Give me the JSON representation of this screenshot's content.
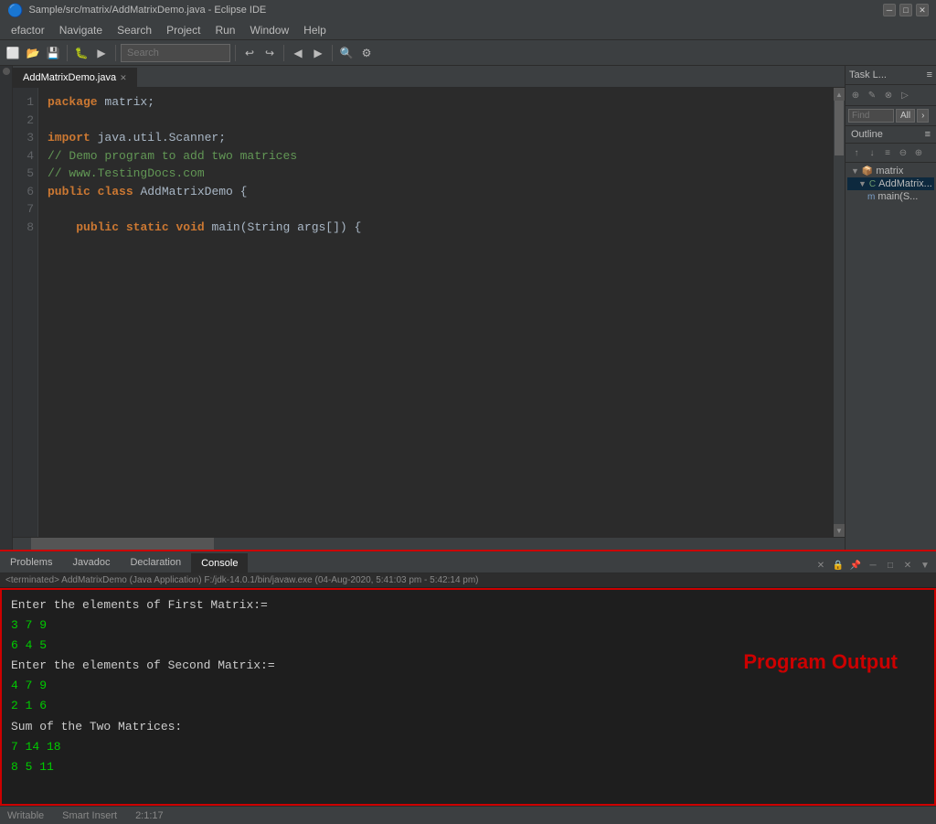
{
  "titlebar": {
    "title": "Sample/src/matrix/AddMatrixDemo.java - Eclipse IDE",
    "minimize": "─",
    "maximize": "□",
    "close": "✕"
  },
  "menubar": {
    "items": [
      "efactor",
      "Navigate",
      "Search",
      "Project",
      "Run",
      "Window",
      "Help"
    ]
  },
  "toolbar": {
    "search_placeholder": "Search"
  },
  "editor": {
    "tab": "AddMatrixDemo.java",
    "lines": [
      {
        "num": "1",
        "content": "package matrix;",
        "parts": [
          {
            "t": "keyword",
            "v": "package"
          },
          {
            "t": "normal",
            "v": " matrix;"
          }
        ]
      },
      {
        "num": "2",
        "content": ""
      },
      {
        "num": "3",
        "content": "import java.util.Scanner;",
        "parts": [
          {
            "t": "keyword",
            "v": "import"
          },
          {
            "t": "normal",
            "v": " java.util.Scanner;"
          }
        ]
      },
      {
        "num": "4",
        "content": "// Demo program to add two matrices",
        "parts": [
          {
            "t": "comment",
            "v": "// Demo program to add two matrices"
          }
        ]
      },
      {
        "num": "5",
        "content": "// www.TestingDocs.com",
        "parts": [
          {
            "t": "comment",
            "v": "// www.TestingDocs.com"
          }
        ]
      },
      {
        "num": "6",
        "content": "public class AddMatrixDemo {",
        "parts": [
          {
            "t": "keyword",
            "v": "public"
          },
          {
            "t": "normal",
            "v": " "
          },
          {
            "t": "keyword",
            "v": "class"
          },
          {
            "t": "normal",
            "v": " AddMatrixDemo {"
          }
        ]
      },
      {
        "num": "7",
        "content": ""
      },
      {
        "num": "8",
        "content": "    public static void main(String args[]) {",
        "parts": [
          {
            "t": "indent",
            "v": "    "
          },
          {
            "t": "keyword",
            "v": "public"
          },
          {
            "t": "normal",
            "v": " "
          },
          {
            "t": "keyword",
            "v": "static"
          },
          {
            "t": "normal",
            "v": " "
          },
          {
            "t": "keyword",
            "v": "void"
          },
          {
            "t": "normal",
            "v": " main(String args[]) {"
          }
        ]
      }
    ]
  },
  "right_panel": {
    "task_label": "Task L...",
    "find_label": "Find",
    "all_label": "All",
    "outline_label": "Outline",
    "tree": {
      "matrix": "matrix",
      "addmatrix": "AddMatrix...",
      "main": "main(S..."
    }
  },
  "bottom_panel": {
    "tabs": [
      "Problems",
      "Javadoc",
      "Declaration",
      "Console"
    ],
    "active_tab": "Console",
    "status_text": "<terminated> AddMatrixDemo (Java Application) F:/jdk-14.0.1/bin/javaw.exe (04-Aug-2020, 5:41:03 pm - 5:42:14 pm)",
    "console_lines": [
      {
        "type": "white",
        "text": "Enter the elements of First Matrix:="
      },
      {
        "type": "green",
        "text": "3 7 9"
      },
      {
        "type": "green",
        "text": "6 4 5"
      },
      {
        "type": "white",
        "text": "Enter the elements of Second Matrix:="
      },
      {
        "type": "green",
        "text": "4 7 9"
      },
      {
        "type": "green",
        "text": "2 1 6"
      },
      {
        "type": "white",
        "text": "Sum of the Two Matrices:"
      },
      {
        "type": "green",
        "text": "7 14 18"
      },
      {
        "type": "green",
        "text": "8 5 11"
      }
    ],
    "program_output_label": "Program Output"
  },
  "status_bar": {
    "writable": "Writable",
    "smart_insert": "Smart Insert",
    "position": "2:1:17"
  }
}
